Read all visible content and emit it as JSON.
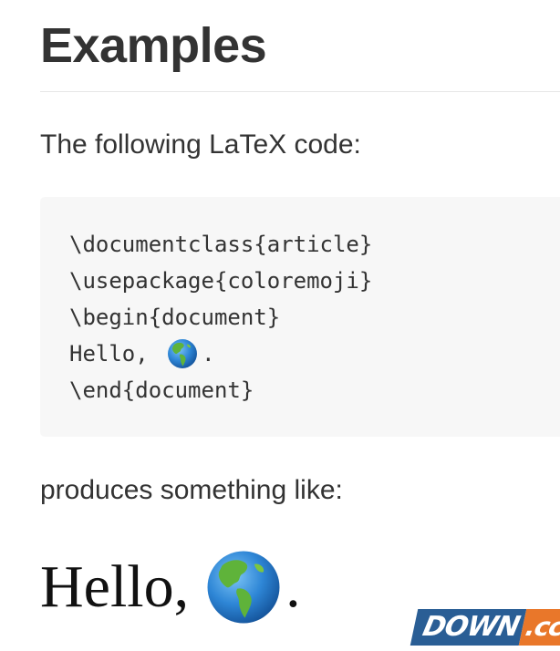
{
  "section": {
    "heading": "Examples"
  },
  "intro": "The following LaTeX code:",
  "code": {
    "lines": [
      "\\documentclass{article}",
      "\\usepackage{coloremoji}",
      "\\begin{document}",
      "Hello, ",
      ".",
      "\\end{document}"
    ],
    "emoji_icon": "globe-americas-emoji"
  },
  "outro": "produces something like:",
  "rendered": {
    "text_before": "Hello,",
    "text_after": ".",
    "emoji_icon": "globe-americas-emoji"
  },
  "watermark": {
    "main": "DOWN",
    "tld": ".cc",
    "colors": {
      "main_bg": "#2a5e95",
      "tld_bg": "#e9772a"
    }
  }
}
